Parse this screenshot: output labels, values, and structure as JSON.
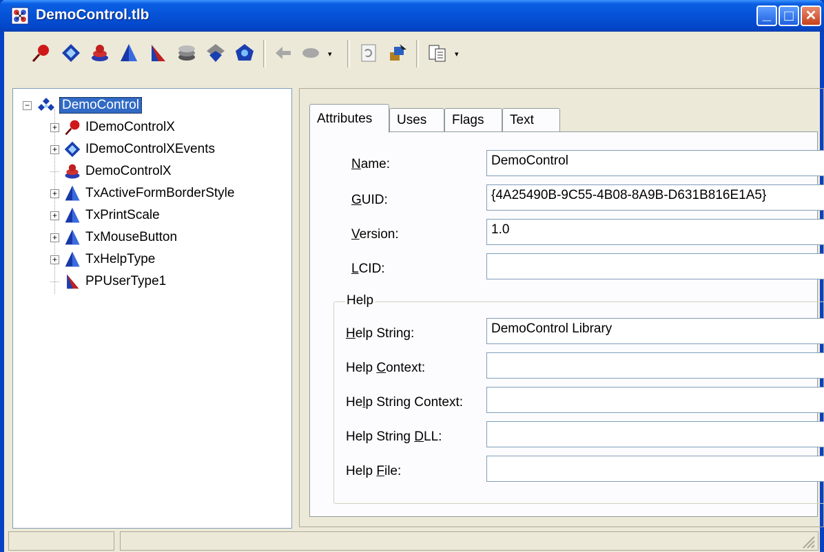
{
  "window": {
    "title": "DemoControl.tlb"
  },
  "caption_buttons": {
    "minimize": "_",
    "maximize": "□",
    "close": "✕"
  },
  "toolbar": {
    "icons": [
      "interface-icon",
      "dispinterface-icon",
      "coclass-icon",
      "enum-icon",
      "record-icon",
      "module-icon",
      "union-icon",
      "alias-icon",
      "method-icon",
      "property-icon",
      "refresh-icon",
      "register-icon",
      "export-icon"
    ],
    "dropdown_glyph": "▾"
  },
  "tree": {
    "root": {
      "label": "DemoControl",
      "expander": "−"
    },
    "items": [
      {
        "label": "IDemoControlX",
        "expander": "+",
        "icon": "interface-icon"
      },
      {
        "label": "IDemoControlXEvents",
        "expander": "+",
        "icon": "dispinterface-icon"
      },
      {
        "label": "DemoControlX",
        "expander": "",
        "icon": "coclass-icon"
      },
      {
        "label": "TxActiveFormBorderStyle",
        "expander": "+",
        "icon": "enum-icon"
      },
      {
        "label": "TxPrintScale",
        "expander": "+",
        "icon": "enum-icon"
      },
      {
        "label": "TxMouseButton",
        "expander": "+",
        "icon": "enum-icon"
      },
      {
        "label": "TxHelpType",
        "expander": "+",
        "icon": "enum-icon"
      },
      {
        "label": "PPUserType1",
        "expander": "",
        "icon": "alias-icon"
      }
    ]
  },
  "tabs": [
    {
      "label": "Attributes",
      "active": true
    },
    {
      "label": "Uses",
      "active": false
    },
    {
      "label": "Flags",
      "active": false
    },
    {
      "label": "Text",
      "active": false
    }
  ],
  "attributes": {
    "name": {
      "label_pre": "",
      "label_u": "N",
      "label_post": "ame:",
      "value": "DemoControl"
    },
    "guid": {
      "label_pre": "",
      "label_u": "G",
      "label_post": "UID:",
      "value": "{4A25490B-9C55-4B08-8A9B-D631B816E1A5}"
    },
    "version": {
      "label_pre": "",
      "label_u": "V",
      "label_post": "ersion:",
      "value": "1.0"
    },
    "lcid": {
      "label_pre": "",
      "label_u": "L",
      "label_post": "CID:",
      "value": ""
    }
  },
  "help": {
    "group_title": "Help",
    "help_string": {
      "label_pre": "",
      "label_u": "H",
      "label_post": "elp String:",
      "value": "DemoControl Library"
    },
    "help_context": {
      "label_pre": "Help ",
      "label_u": "C",
      "label_post": "ontext:",
      "value": ""
    },
    "help_string_context": {
      "label_pre": "He",
      "label_u": "l",
      "label_post": "p String Context:",
      "value": ""
    },
    "help_string_dll": {
      "label_pre": "Help String ",
      "label_u": "D",
      "label_post": "LL:",
      "value": ""
    },
    "help_file": {
      "label_pre": "Help ",
      "label_u": "F",
      "label_post": "ile:",
      "value": ""
    }
  },
  "colors": {
    "titlebar": "#0552d6",
    "selection": "#316ac5",
    "face": "#ece9d8"
  }
}
